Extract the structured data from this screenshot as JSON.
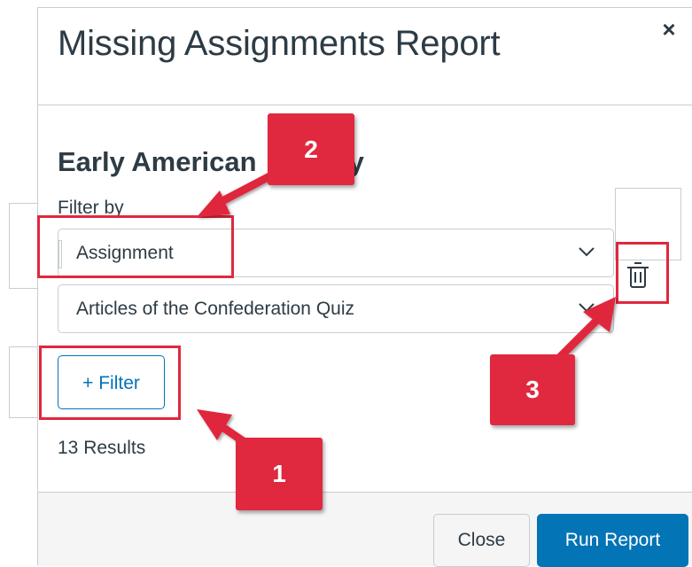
{
  "modal": {
    "title": "Missing Assignments Report",
    "close_glyph": "×"
  },
  "course": {
    "title": "Early American History",
    "title_visible_start": "Early American",
    "title_visible_end": "ry"
  },
  "filter": {
    "label": "Filter by",
    "type_value": "Assignment",
    "assignment_value": "Articles of the Confederation Quiz",
    "add_filter_label": "+ Filter",
    "delete_icon": "trash-icon",
    "chevron_icon": "chevron-down-icon"
  },
  "results": {
    "text": "13 Results"
  },
  "footer": {
    "close_label": "Close",
    "run_label": "Run Report"
  },
  "annotations": {
    "callout_1": "1",
    "callout_2": "2",
    "callout_3": "3"
  },
  "colors": {
    "accent": "#0374b5",
    "annotation": "#e0283e",
    "text": "#2d3b45",
    "border": "#c7cdd1",
    "footer_bg": "#f5f5f5"
  }
}
